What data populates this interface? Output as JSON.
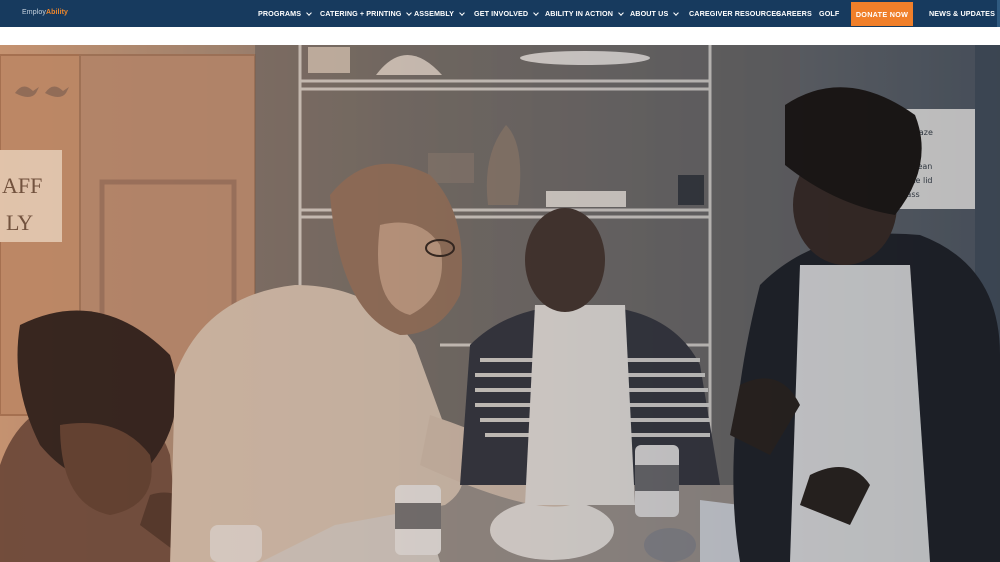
{
  "logo": {
    "part1": "Employ",
    "part2": "Ability"
  },
  "nav": {
    "items": [
      {
        "label": "PROGRAMS",
        "has_dropdown": true
      },
      {
        "label": "CATERING + PRINTING",
        "has_dropdown": true
      },
      {
        "label": "ASSEMBLY",
        "has_dropdown": true
      },
      {
        "label": "GET INVOLVED",
        "has_dropdown": true
      },
      {
        "label": "ABILITY IN ACTION",
        "has_dropdown": true
      },
      {
        "label": "ABOUT US",
        "has_dropdown": true
      },
      {
        "label": "CAREGIVER RESOURCES",
        "has_dropdown": false
      },
      {
        "label": "CAREERS",
        "has_dropdown": false
      },
      {
        "label": "GOLF",
        "has_dropdown": false
      }
    ],
    "donate_label": "DONATE NOW",
    "news_label": "NEWS & UPDATES"
  },
  "hero": {
    "sign_text_line1": "AFF",
    "sign_text_line2": "LY",
    "whiteboard_lines": [
      "- Glaze",
      "es Clean",
      "Glaze lid",
      "Glass"
    ]
  },
  "colors": {
    "nav_bg": "#173a5e",
    "accent_orange": "#f07f2a",
    "overlay_warm": "#c98c62",
    "overlay_cool": "#2b3f55"
  }
}
